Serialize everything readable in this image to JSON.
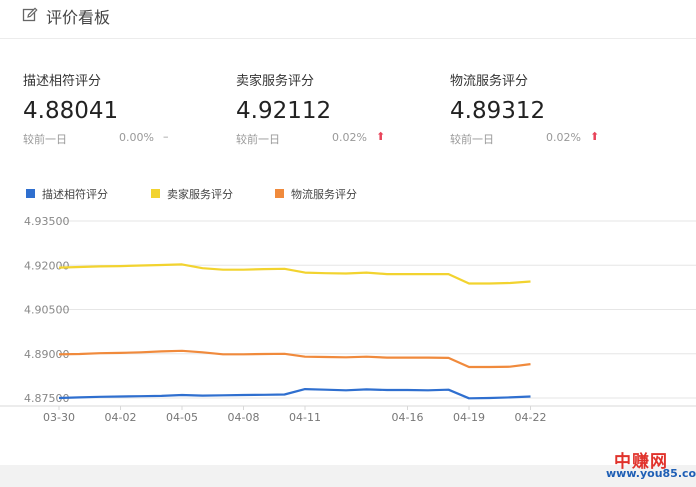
{
  "header": {
    "icon": "edit-icon",
    "title": "评价看板"
  },
  "metrics": [
    {
      "label": "描述相符评分",
      "value": "4.88041",
      "compare_label": "较前一日",
      "change": "0.00%",
      "trend_symbol": "–",
      "trend": "flat"
    },
    {
      "label": "卖家服务评分",
      "value": "4.92112",
      "compare_label": "较前一日",
      "change": "0.02%",
      "trend_symbol": "⬆",
      "trend": "up"
    },
    {
      "label": "物流服务评分",
      "value": "4.89312",
      "compare_label": "较前一日",
      "change": "0.02%",
      "trend_symbol": "⬆",
      "trend": "up"
    }
  ],
  "colors": {
    "series_blue": "#2f6fcf",
    "series_yellow": "#f2d32f",
    "series_orange": "#f08a3c",
    "trend_up": "#e8445a",
    "grid": "#e6e6e6"
  },
  "chart_data": {
    "type": "line",
    "x": [
      "03-30",
      "03-31",
      "04-01",
      "04-02",
      "04-03",
      "04-04",
      "04-05",
      "04-06",
      "04-07",
      "04-08",
      "04-09",
      "04-10",
      "04-11",
      "04-12",
      "04-13",
      "04-14",
      "04-15",
      "04-16",
      "04-17",
      "04-18",
      "04-19",
      "04-20",
      "04-21",
      "04-22"
    ],
    "x_tick_labels": [
      "03-30",
      "04-02",
      "04-05",
      "04-08",
      "04-11",
      "04-16",
      "04-19",
      "04-22"
    ],
    "y_ticks": [
      "4.93500",
      "4.92000",
      "4.90500",
      "4.89000",
      "4.87500"
    ],
    "ylim": [
      4.875,
      4.935
    ],
    "grid": true,
    "legend_position": "top-left",
    "series": [
      {
        "name": "描述相符评分",
        "color": "#2f6fcf",
        "values": [
          4.875,
          4.8752,
          4.8754,
          4.8755,
          4.8756,
          4.8757,
          4.876,
          4.8758,
          4.8759,
          4.876,
          4.8761,
          4.8762,
          4.878,
          4.8778,
          4.8776,
          4.8779,
          4.8777,
          4.8777,
          4.8776,
          4.8778,
          4.8749,
          4.875,
          4.8752,
          4.8755
        ]
      },
      {
        "name": "卖家服务评分",
        "color": "#f2d32f",
        "values": [
          4.9192,
          4.9194,
          4.9196,
          4.9197,
          4.9199,
          4.9201,
          4.9203,
          4.919,
          4.9185,
          4.9185,
          4.9187,
          4.9188,
          4.9175,
          4.9173,
          4.9172,
          4.9175,
          4.917,
          4.917,
          4.917,
          4.917,
          4.9138,
          4.9138,
          4.914,
          4.9145
        ]
      },
      {
        "name": "物流服务评分",
        "color": "#f08a3c",
        "values": [
          4.8898,
          4.8899,
          4.8902,
          4.8903,
          4.8905,
          4.8908,
          4.891,
          4.8905,
          4.8898,
          4.8898,
          4.8899,
          4.89,
          4.889,
          4.8889,
          4.8888,
          4.889,
          4.8887,
          4.8887,
          4.8887,
          4.8886,
          4.8855,
          4.8855,
          4.8856,
          4.8865
        ]
      }
    ]
  },
  "watermark": {
    "brand": "中赚网",
    "url": "www.you85.com"
  }
}
